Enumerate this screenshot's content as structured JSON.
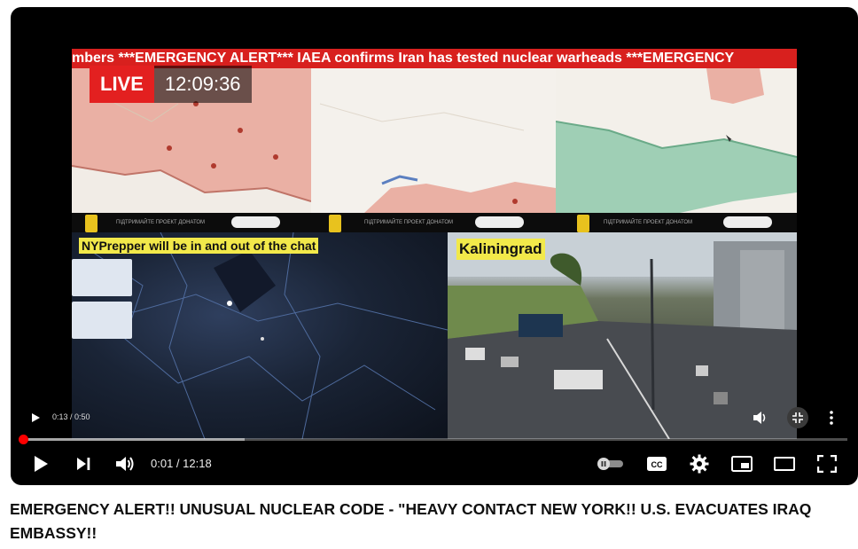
{
  "video": {
    "ticker_text": "mbers ***EMERGENCY ALERT*** IAEA confirms Iran has tested nuclear warheads ***EMERGENCY",
    "live_label": "LIVE",
    "live_time": "12:09:36",
    "caption_left": "NYPrepper will be in and out of the chat",
    "caption_right": "Kaliningrad",
    "donate_text": "ПІДТРИМАЙТЕ ПРОЕКТ ДОНАТОМ",
    "inner_time": "0:13 / 0:50"
  },
  "player": {
    "time_display": "0:01 / 12:18",
    "progress_fraction": 0.002,
    "buffered_fraction": 0.27,
    "accent_color": "#ff0000"
  },
  "title": "EMERGENCY ALERT!! UNUSUAL NUCLEAR CODE - \"HEAVY CONTACT NEW YORK!! U.S. EVACUATES IRAQ EMBASSY!!"
}
